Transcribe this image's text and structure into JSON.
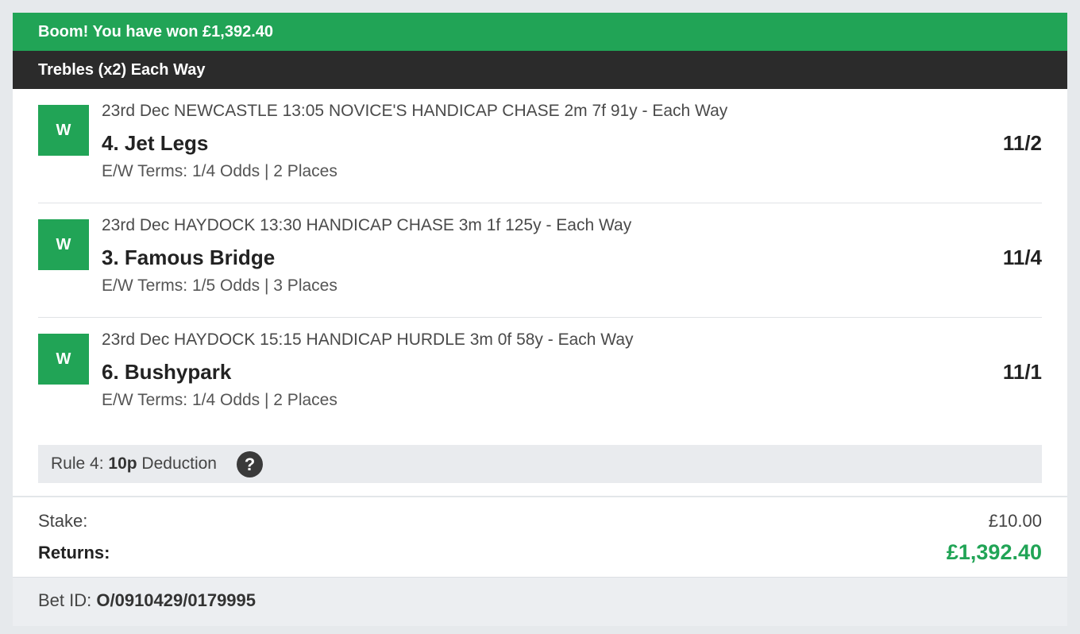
{
  "banner": {
    "text": "Boom! You have won £1,392.40"
  },
  "bet": {
    "type": "Trebles (x2) Each Way"
  },
  "selections": [
    {
      "result": "W",
      "event": "23rd Dec NEWCASTLE 13:05 NOVICE'S HANDICAP CHASE 2m 7f 91y - Each Way",
      "runner": "4. Jet Legs",
      "odds": "11/2",
      "terms": "E/W Terms: 1/4 Odds | 2 Places"
    },
    {
      "result": "W",
      "event": "23rd Dec HAYDOCK 13:30 HANDICAP CHASE 3m 1f 125y - Each Way",
      "runner": "3. Famous Bridge",
      "odds": "11/4",
      "terms": "E/W Terms: 1/5 Odds | 3 Places"
    },
    {
      "result": "W",
      "event": "23rd Dec HAYDOCK 15:15 HANDICAP HURDLE 3m 0f 58y - Each Way",
      "runner": "6. Bushypark",
      "odds": "11/1",
      "terms": "E/W Terms: 1/4 Odds | 2 Places"
    }
  ],
  "rule4": {
    "prefix": "Rule 4:",
    "amount": "10p",
    "suffix": "Deduction",
    "help_icon": "question-mark-icon",
    "help_glyph": "?"
  },
  "totals": {
    "stake_label": "Stake:",
    "stake_value": "£10.00",
    "returns_label": "Returns:",
    "returns_value": "£1,392.40"
  },
  "bet_id": {
    "label": "Bet ID:",
    "value": "O/0910429/0179995"
  },
  "colors": {
    "win_green": "#21a456",
    "header_dark": "#2b2b2b",
    "page_background": "#e6e9ec"
  }
}
